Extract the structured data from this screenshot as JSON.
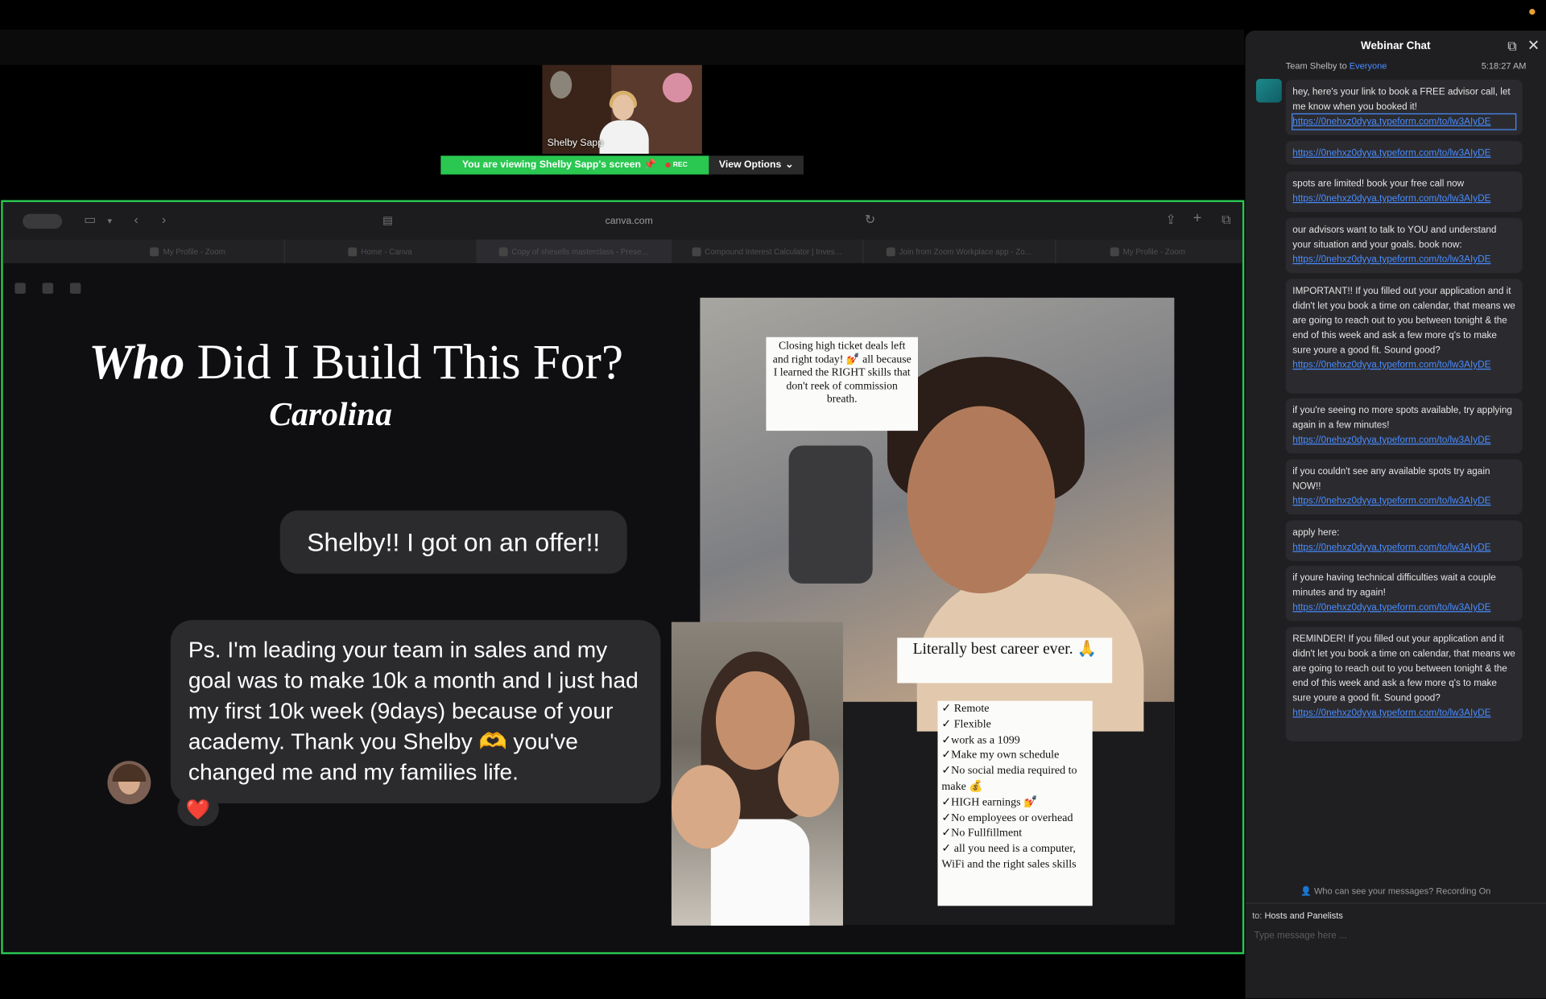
{
  "meeting": {
    "camera_name": "Shelby Sapp",
    "viewing_prefix": "You are viewing",
    "viewing_name": "Shelby Sapp's screen",
    "rec_label": "REC",
    "view_options_label": "View Options"
  },
  "browser": {
    "url": "canva.com",
    "tabs": [
      {
        "label": "My Profile - Zoom"
      },
      {
        "label": "Home - Canva"
      },
      {
        "label": "Copy of shesells masterclass - Prese..."
      },
      {
        "label": "Compound Interest Calculator | Inves..."
      },
      {
        "label": "Join from Zoom Workplace app - Zo..."
      },
      {
        "label": "My Profile - Zoom"
      }
    ]
  },
  "slide": {
    "title_italic": "Who",
    "title_rest": "Did I Build This For?",
    "subtitle": "Carolina",
    "bubble1": "Shelby!! I got on an offer!!",
    "bubble2": "Ps. I'm leading your team in sales and my goal was to make 10k a month and I just had my first 10k week (9days) because of your academy. Thank you Shelby 🫶 you've changed me and my families life.",
    "reaction": "❤️",
    "note1": "Closing high ticket deals left and right today! 💅 all because I learned the RIGHT skills that don't reek of commission breath.",
    "note2": "Literally best career ever. 🙏",
    "checklist": [
      "✓ Remote",
      "✓ Flexible",
      "✓work as a 1099",
      "✓Make my own schedule",
      "✓No social media required to make 💰",
      "✓HIGH earnings 💅",
      "✓No employees or overhead",
      "✓No Fullfillment",
      "✓ all you need is a computer, WiFi and the right sales skills"
    ]
  },
  "chat": {
    "title": "Webinar Chat",
    "from": "Team Shelby",
    "to_word": "to",
    "to": "Everyone",
    "time": "5:18:27 AM",
    "messages": [
      {
        "text": "hey, here's your link to book a FREE advisor call, let me know when you booked it!",
        "link": "https://0nehxz0dyya.typeform.com/to/lw3AIyDE"
      },
      {
        "text": "",
        "link": "https://0nehxz0dyya.typeform.com/to/lw3AIyDE"
      },
      {
        "text": "spots are limited! book your free call now",
        "link": "https://0nehxz0dyya.typeform.com/to/lw3AIyDE"
      },
      {
        "text": "our advisors want to talk to YOU and understand your situation and your goals. book now:",
        "link": "https://0nehxz0dyya.typeform.com/to/lw3AIyDE"
      },
      {
        "text": "IMPORTANT!! If you filled out your application and it didn't let you book a time on calendar, that means we are going to reach out to you between tonight & the end of this week and ask a few more q's to make sure youre a good fit. Sound good?",
        "link": "https://0nehxz0dyya.typeform.com/to/lw3AIyDE"
      },
      {
        "text": "if you're seeing no more spots available, try applying again in a few minutes!",
        "link": "https://0nehxz0dyya.typeform.com/to/lw3AIyDE"
      },
      {
        "text": "if you couldn't see any available spots try again NOW!!",
        "link": "https://0nehxz0dyya.typeform.com/to/lw3AIyDE"
      },
      {
        "text": "apply here:",
        "link": "https://0nehxz0dyya.typeform.com/to/lw3AIyDE"
      },
      {
        "text": "if youre having technical difficulties wait a couple minutes and try again!",
        "link": "https://0nehxz0dyya.typeform.com/to/lw3AIyDE"
      },
      {
        "text": "REMINDER! If you filled out your application and it didn't let you book a time on calendar, that means we are going to reach out to you between tonight & the end of this week and ask a few more q's to make sure youre a good fit. Sound good?",
        "link": "https://0nehxz0dyya.typeform.com/to/lw3AIyDE"
      }
    ],
    "visibility_note": "Who can see your messages? Recording On",
    "to_label": "to:",
    "to_target": "Hosts and Panelists",
    "input_placeholder": "Type message here ..."
  },
  "colors": {
    "share_border": "#2ac751",
    "link": "#4a8cff",
    "chat_bg": "#1f1f22"
  }
}
